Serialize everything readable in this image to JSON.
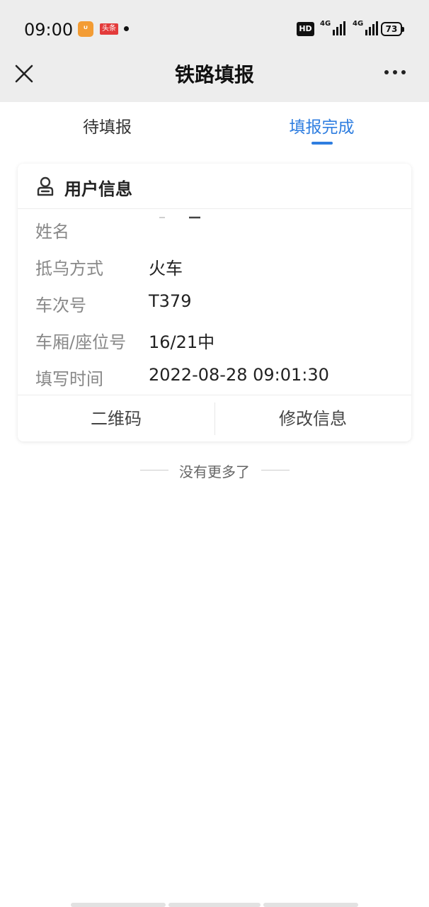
{
  "status_bar": {
    "time": "09:00",
    "uc_icon": "uc-browser-icon",
    "toutiao_label": "头条",
    "hd_label": "HD",
    "network_1": "4G",
    "network_2": "4G",
    "battery": "73"
  },
  "header": {
    "title": "铁路填报",
    "close_icon": "close-icon",
    "more_icon": "more-horizontal-icon"
  },
  "tabs": [
    {
      "label": "待填报",
      "active": false
    },
    {
      "label": "填报完成",
      "active": true
    }
  ],
  "accent_color": "#2f7ee0",
  "card": {
    "title": "用户信息",
    "icon": "user-icon",
    "rows": [
      {
        "label": "姓名",
        "value": ""
      },
      {
        "label": "抵乌方式",
        "value": "火车"
      },
      {
        "label": "车次号",
        "value": "T379"
      },
      {
        "label": "车厢/座位号",
        "value": "16/21中"
      },
      {
        "label": "填写时间",
        "value": "2022-08-28 09:01:30"
      }
    ],
    "actions": {
      "qrcode": "二维码",
      "edit": "修改信息"
    }
  },
  "footer": {
    "no_more": "没有更多了"
  }
}
